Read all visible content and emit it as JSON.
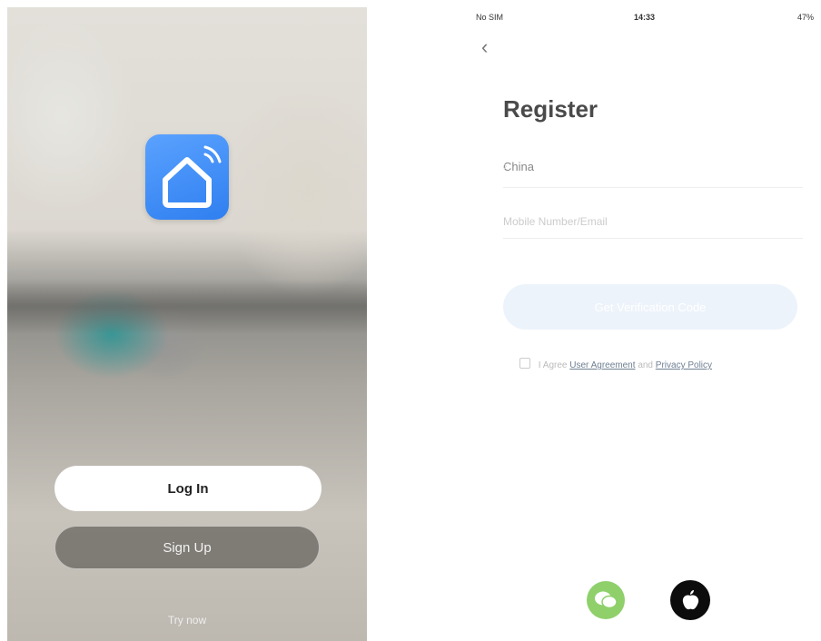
{
  "welcome": {
    "login_label": "Log In",
    "signup_label": "Sign Up",
    "try_now_label": "Try now",
    "icon": "smart-home-wifi-icon",
    "accent_color": "#3a8cf6"
  },
  "register": {
    "status": {
      "carrier": "No SIM",
      "time": "14:33",
      "battery": "47%"
    },
    "title": "Register",
    "country": "China",
    "phone_placeholder": "Mobile Number/Email",
    "code_button": "Get Verification Code",
    "agree_prefix": "I Agree",
    "user_agreement": "User Agreement",
    "and": "and",
    "privacy_policy": "Privacy Policy",
    "social": [
      "wechat-icon",
      "apple-icon"
    ]
  }
}
